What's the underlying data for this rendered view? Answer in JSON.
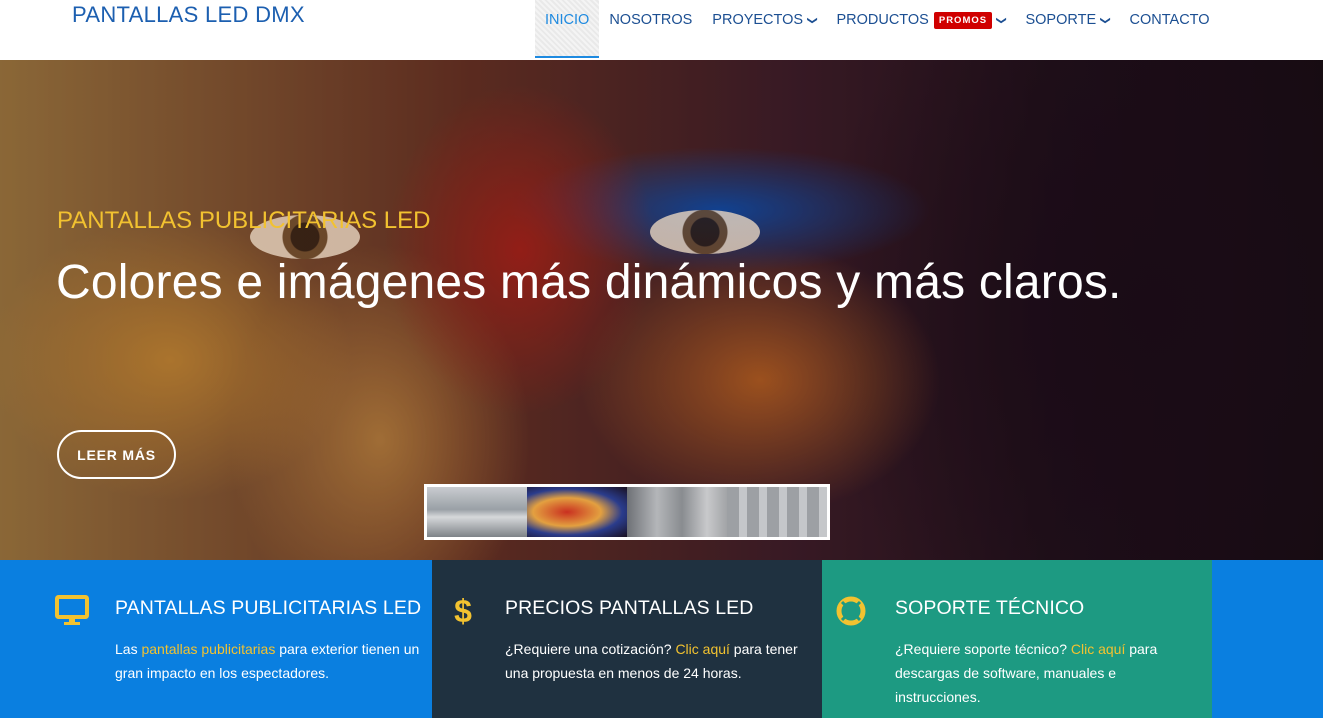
{
  "brand": {
    "logo_text": "PANTALLAS LED DMX"
  },
  "nav": {
    "items": [
      {
        "label": "INICIO",
        "active": true,
        "dropdown": false
      },
      {
        "label": "NOSOTROS",
        "active": false,
        "dropdown": false
      },
      {
        "label": "PROYECTOS",
        "active": false,
        "dropdown": true
      },
      {
        "label": "PRODUCTOS",
        "active": false,
        "dropdown": true,
        "badge": "PROMOS"
      },
      {
        "label": "SOPORTE",
        "active": false,
        "dropdown": true
      },
      {
        "label": "CONTACTO",
        "active": false,
        "dropdown": false
      }
    ],
    "chevron_icon": "chevron-down-icon"
  },
  "hero": {
    "subtitle": "PANTALLAS PUBLICITARIAS LED",
    "title": "Colores e imágenes más dinámicos y más claros.",
    "button_label": "LEER MÁS",
    "thumbnail_count": 4,
    "active_thumbnail": 2
  },
  "features": [
    {
      "icon": "monitor-icon",
      "title": "PANTALLAS PUBLICITARIAS LED",
      "text_before": "Las ",
      "link": "pantallas publicitarias",
      "text_after": " para exterior tienen un gran impacto en los espectadores."
    },
    {
      "icon": "dollar-icon",
      "title": "PRECIOS PANTALLAS LED",
      "text_before": "¿Requiere una cotización? ",
      "link": "Clic aquí",
      "text_after": " para tener una propuesta en menos de 24 horas."
    },
    {
      "icon": "lifebuoy-icon",
      "title": "SOPORTE TÉCNICO",
      "text_before": "¿Requiere soporte técnico? ",
      "link": "Clic aquí",
      "text_after": " para descargas de software, manuales e instrucciones."
    }
  ],
  "colors": {
    "brand_blue": "#1c5fb0",
    "accent_yellow": "#f2c230",
    "promo_red": "#d00000",
    "box1_bg": "#0a7fe0",
    "box2_bg": "#1f3140",
    "box3_bg": "#1d9a82"
  }
}
